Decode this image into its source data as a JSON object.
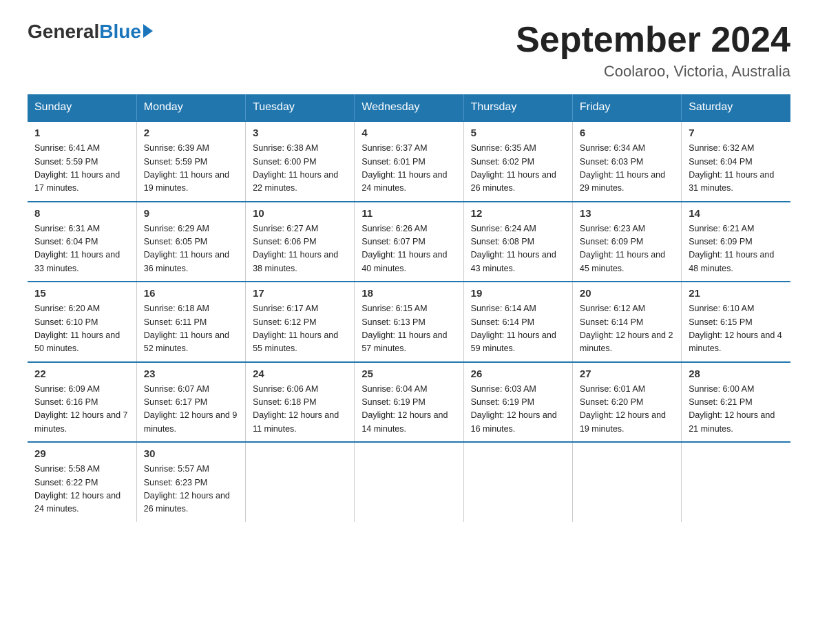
{
  "logo": {
    "general": "General",
    "blue": "Blue"
  },
  "title": "September 2024",
  "location": "Coolaroo, Victoria, Australia",
  "weekdays": [
    "Sunday",
    "Monday",
    "Tuesday",
    "Wednesday",
    "Thursday",
    "Friday",
    "Saturday"
  ],
  "weeks": [
    [
      {
        "day": "1",
        "sunrise": "6:41 AM",
        "sunset": "5:59 PM",
        "daylight": "11 hours and 17 minutes."
      },
      {
        "day": "2",
        "sunrise": "6:39 AM",
        "sunset": "5:59 PM",
        "daylight": "11 hours and 19 minutes."
      },
      {
        "day": "3",
        "sunrise": "6:38 AM",
        "sunset": "6:00 PM",
        "daylight": "11 hours and 22 minutes."
      },
      {
        "day": "4",
        "sunrise": "6:37 AM",
        "sunset": "6:01 PM",
        "daylight": "11 hours and 24 minutes."
      },
      {
        "day": "5",
        "sunrise": "6:35 AM",
        "sunset": "6:02 PM",
        "daylight": "11 hours and 26 minutes."
      },
      {
        "day": "6",
        "sunrise": "6:34 AM",
        "sunset": "6:03 PM",
        "daylight": "11 hours and 29 minutes."
      },
      {
        "day": "7",
        "sunrise": "6:32 AM",
        "sunset": "6:04 PM",
        "daylight": "11 hours and 31 minutes."
      }
    ],
    [
      {
        "day": "8",
        "sunrise": "6:31 AM",
        "sunset": "6:04 PM",
        "daylight": "11 hours and 33 minutes."
      },
      {
        "day": "9",
        "sunrise": "6:29 AM",
        "sunset": "6:05 PM",
        "daylight": "11 hours and 36 minutes."
      },
      {
        "day": "10",
        "sunrise": "6:27 AM",
        "sunset": "6:06 PM",
        "daylight": "11 hours and 38 minutes."
      },
      {
        "day": "11",
        "sunrise": "6:26 AM",
        "sunset": "6:07 PM",
        "daylight": "11 hours and 40 minutes."
      },
      {
        "day": "12",
        "sunrise": "6:24 AM",
        "sunset": "6:08 PM",
        "daylight": "11 hours and 43 minutes."
      },
      {
        "day": "13",
        "sunrise": "6:23 AM",
        "sunset": "6:09 PM",
        "daylight": "11 hours and 45 minutes."
      },
      {
        "day": "14",
        "sunrise": "6:21 AM",
        "sunset": "6:09 PM",
        "daylight": "11 hours and 48 minutes."
      }
    ],
    [
      {
        "day": "15",
        "sunrise": "6:20 AM",
        "sunset": "6:10 PM",
        "daylight": "11 hours and 50 minutes."
      },
      {
        "day": "16",
        "sunrise": "6:18 AM",
        "sunset": "6:11 PM",
        "daylight": "11 hours and 52 minutes."
      },
      {
        "day": "17",
        "sunrise": "6:17 AM",
        "sunset": "6:12 PM",
        "daylight": "11 hours and 55 minutes."
      },
      {
        "day": "18",
        "sunrise": "6:15 AM",
        "sunset": "6:13 PM",
        "daylight": "11 hours and 57 minutes."
      },
      {
        "day": "19",
        "sunrise": "6:14 AM",
        "sunset": "6:14 PM",
        "daylight": "11 hours and 59 minutes."
      },
      {
        "day": "20",
        "sunrise": "6:12 AM",
        "sunset": "6:14 PM",
        "daylight": "12 hours and 2 minutes."
      },
      {
        "day": "21",
        "sunrise": "6:10 AM",
        "sunset": "6:15 PM",
        "daylight": "12 hours and 4 minutes."
      }
    ],
    [
      {
        "day": "22",
        "sunrise": "6:09 AM",
        "sunset": "6:16 PM",
        "daylight": "12 hours and 7 minutes."
      },
      {
        "day": "23",
        "sunrise": "6:07 AM",
        "sunset": "6:17 PM",
        "daylight": "12 hours and 9 minutes."
      },
      {
        "day": "24",
        "sunrise": "6:06 AM",
        "sunset": "6:18 PM",
        "daylight": "12 hours and 11 minutes."
      },
      {
        "day": "25",
        "sunrise": "6:04 AM",
        "sunset": "6:19 PM",
        "daylight": "12 hours and 14 minutes."
      },
      {
        "day": "26",
        "sunrise": "6:03 AM",
        "sunset": "6:19 PM",
        "daylight": "12 hours and 16 minutes."
      },
      {
        "day": "27",
        "sunrise": "6:01 AM",
        "sunset": "6:20 PM",
        "daylight": "12 hours and 19 minutes."
      },
      {
        "day": "28",
        "sunrise": "6:00 AM",
        "sunset": "6:21 PM",
        "daylight": "12 hours and 21 minutes."
      }
    ],
    [
      {
        "day": "29",
        "sunrise": "5:58 AM",
        "sunset": "6:22 PM",
        "daylight": "12 hours and 24 minutes."
      },
      {
        "day": "30",
        "sunrise": "5:57 AM",
        "sunset": "6:23 PM",
        "daylight": "12 hours and 26 minutes."
      },
      null,
      null,
      null,
      null,
      null
    ]
  ]
}
